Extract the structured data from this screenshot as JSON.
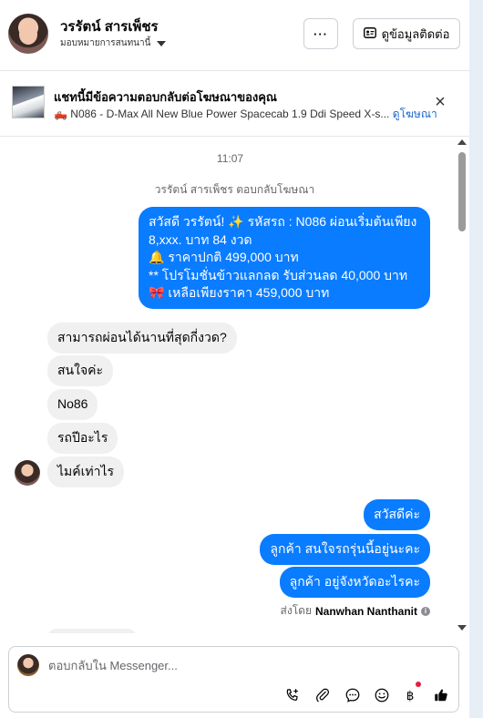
{
  "header": {
    "name": "วรรัตน์ สารเพ็ชร",
    "subtitle": "มอบหมายการสนทนานี้",
    "more_label": "···",
    "contact_label": "ดูข้อมูลติดต่อ"
  },
  "ad": {
    "title": "แชทนี้มีข้อความตอบกลับต่อโฆษณาของคุณ",
    "line": "🛻 N086 - D-Max All New Blue Power Spacecab 1.9 Ddi Speed X-s...",
    "link": "ดูโฆษณา"
  },
  "chat": {
    "time": "11:07",
    "replied_note": "วรรัตน์ สารเพ็ชร ตอบกลับโฆษณา",
    "messages": [
      {
        "dir": "out",
        "text": "สวัสดี วรรัตน์! ✨ รหัสรถ : N086 ผ่อนเริ่มต้นเพียง\n8,xxx. บาท 84 งวด\n🔔 ราคาปกติ 499,000 บาท\n** โปรโมชั่นข้าวแลกลด รับส่วนลด 40,000 บาท\n🎀 เหลือเพียงราคา 459,000 บาท"
      },
      {
        "dir": "in",
        "text": "สามารถผ่อนได้นานที่สุดกี่งวด?"
      },
      {
        "dir": "in",
        "text": "สนใจค่ะ"
      },
      {
        "dir": "in",
        "text": "No86"
      },
      {
        "dir": "in",
        "text": "รถปีอะไร"
      },
      {
        "dir": "in",
        "text": "ไมค์เท่าไร"
      },
      {
        "dir": "out",
        "text": "สวัสดีค่ะ"
      },
      {
        "dir": "out",
        "text": "ลูกค้า สนใจรถรุ่นนี้อยู่นะคะ"
      },
      {
        "dir": "out",
        "text": "ลูกค้า อยู่จังหวัดอะไรคะ"
      }
    ],
    "sent_by_prefix": "ส่งโดย",
    "sent_by_name": "Nanwhan Nanthanit",
    "info_icon": "i"
  },
  "composer": {
    "placeholder": "ตอบกลับใน Messenger...",
    "tools": [
      "phone-plus-icon",
      "paperclip-icon",
      "chat-bubble-icon",
      "emoji-icon",
      "baht-icon",
      "thumbs-up-icon"
    ]
  },
  "colors": {
    "outgoing": "#0a7cff",
    "incoming": "#f0f0f0",
    "link": "#1a66c9"
  }
}
